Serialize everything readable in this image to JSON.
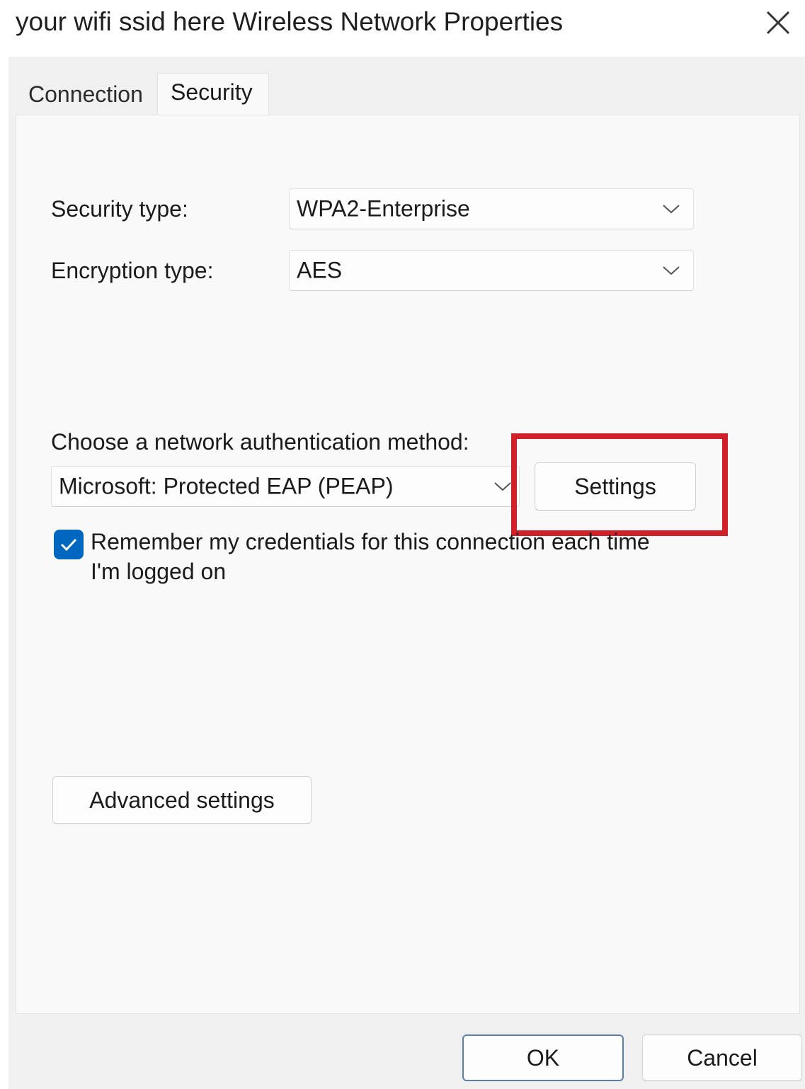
{
  "window": {
    "title": "your wifi ssid here Wireless Network Properties"
  },
  "tabs": [
    {
      "label": "Connection",
      "active": false
    },
    {
      "label": "Security",
      "active": true
    }
  ],
  "security": {
    "security_type_label": "Security type:",
    "security_type_value": "WPA2-Enterprise",
    "encryption_type_label": "Encryption type:",
    "encryption_type_value": "AES",
    "auth_method_label": "Choose a network authentication method:",
    "auth_method_value": "Microsoft: Protected EAP (PEAP)",
    "settings_button": "Settings",
    "remember_credentials_checked": true,
    "remember_credentials_label": "Remember my credentials for this connection each time I'm logged on",
    "advanced_settings_button": "Advanced settings"
  },
  "footer": {
    "ok_button": "OK",
    "cancel_button": "Cancel"
  },
  "colors": {
    "accent": "#0067c0",
    "highlight": "#d0202a",
    "dialog_background": "#f0f0f0",
    "panel_background": "#f9f9f9"
  },
  "icons": [
    "close-icon",
    "chevron-down-icon",
    "checkmark-icon"
  ]
}
